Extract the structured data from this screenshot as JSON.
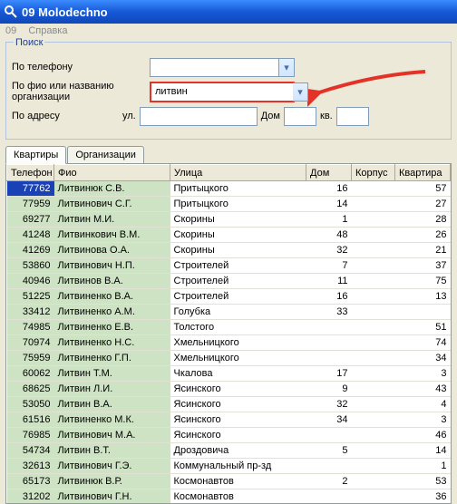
{
  "window": {
    "title": "09 Molodechno"
  },
  "menu": {
    "item1": "09",
    "item2": "Справка"
  },
  "search": {
    "legend": "Поиск",
    "phone_label": "По телефону",
    "fio_label": "По фио или названию",
    "fio_label2": "организации",
    "fio_value": "литвин",
    "addr_label": "По адресу",
    "street_label": "ул.",
    "house_label": "Дом",
    "flat_label": "кв."
  },
  "tabs": {
    "flats": "Квартиры",
    "orgs": "Организации"
  },
  "columns": {
    "phone": "Телефон",
    "fio": "Фио",
    "street": "Улица",
    "house": "Дом",
    "korpus": "Корпус",
    "flat": "Квартира"
  },
  "rows": [
    {
      "phone": "77762",
      "fio": "Литвинюк С.В.",
      "street": "Притыцкого",
      "house": "16",
      "flat": "57",
      "sel": true
    },
    {
      "phone": "77959",
      "fio": "Литвинович С.Г.",
      "street": "Притыцкого",
      "house": "14",
      "flat": "27"
    },
    {
      "phone": "69277",
      "fio": "Литвин М.И.",
      "street": "Скорины",
      "house": "1",
      "flat": "28"
    },
    {
      "phone": "41248",
      "fio": "Литвинкович В.М.",
      "street": "Скорины",
      "house": "48",
      "flat": "26"
    },
    {
      "phone": "41269",
      "fio": "Литвинова О.А.",
      "street": "Скорины",
      "house": "32",
      "flat": "21"
    },
    {
      "phone": "53860",
      "fio": "Литвинович Н.П.",
      "street": "Строителей",
      "house": "7",
      "flat": "37"
    },
    {
      "phone": "40946",
      "fio": "Литвинов В.А.",
      "street": "Строителей",
      "house": "11",
      "flat": "75"
    },
    {
      "phone": "51225",
      "fio": "Литвиненко В.А.",
      "street": "Строителей",
      "house": "16",
      "flat": "13"
    },
    {
      "phone": "33412",
      "fio": "Литвиненко А.М.",
      "street": "Голубка",
      "house": "33",
      "flat": ""
    },
    {
      "phone": "74985",
      "fio": "Литвиненко Е.В.",
      "street": "Толстого",
      "house": "",
      "flat": "51"
    },
    {
      "phone": "70974",
      "fio": "Литвиненко Н.С.",
      "street": "Хмельницкого",
      "house": "",
      "flat": "74"
    },
    {
      "phone": "75959",
      "fio": "Литвиненко Г.П.",
      "street": "Хмельницкого",
      "house": "",
      "flat": "34"
    },
    {
      "phone": "60062",
      "fio": "Литвин Т.М.",
      "street": "Чкалова",
      "house": "17",
      "flat": "3"
    },
    {
      "phone": "68625",
      "fio": "Литвин Л.И.",
      "street": "Ясинского",
      "house": "9",
      "flat": "43"
    },
    {
      "phone": "53050",
      "fio": "Литвин В.А.",
      "street": "Ясинского",
      "house": "32",
      "flat": "4"
    },
    {
      "phone": "61516",
      "fio": "Литвиненко М.К.",
      "street": "Ясинского",
      "house": "34",
      "flat": "3"
    },
    {
      "phone": "76985",
      "fio": "Литвинович М.А.",
      "street": "Ясинского",
      "house": "",
      "flat": "46"
    },
    {
      "phone": "54734",
      "fio": "Литвин В.Т.",
      "street": "Дроздовича",
      "house": "5",
      "flat": "14"
    },
    {
      "phone": "32613",
      "fio": "Литвинович Г.Э.",
      "street": "Коммунальный пр-зд",
      "house": "",
      "flat": "1"
    },
    {
      "phone": "65173",
      "fio": "Литвинюк В.Р.",
      "street": "Космонавтов",
      "house": "2",
      "flat": "53"
    },
    {
      "phone": "31202",
      "fio": "Литвинович Г.Н.",
      "street": "Космонавтов",
      "house": "",
      "flat": "36"
    }
  ]
}
